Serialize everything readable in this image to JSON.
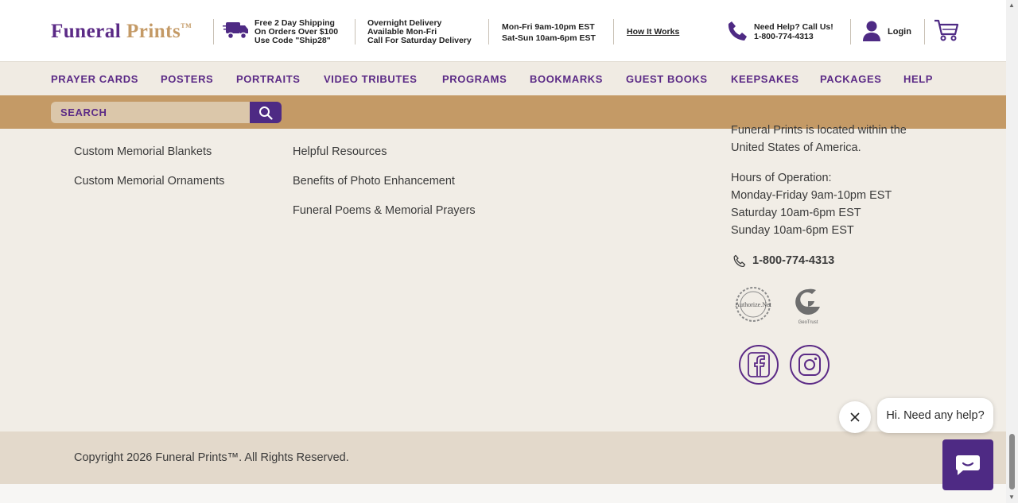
{
  "brand": {
    "logo_word1": "Funeral",
    "logo_word2": "Prints",
    "logo_tm": "TM"
  },
  "header": {
    "shipping": [
      "Free 2 Day Shipping",
      "On Orders Over $100",
      "Use Code \"Ship28\""
    ],
    "overnight": [
      "Overnight Delivery",
      "Available Mon-Fri",
      "Call For Saturday Delivery"
    ],
    "hours": [
      "Mon-Fri 9am-10pm EST",
      "Sat-Sun 10am-6pm EST"
    ],
    "how_it_works": "How It Works",
    "help_line1": "Need Help? Call Us!",
    "help_line2": "1-800-774-4313",
    "login": "Login"
  },
  "nav": [
    "PRAYER CARDS",
    "POSTERS",
    "PORTRAITS",
    "VIDEO TRIBUTES",
    "PROGRAMS",
    "BOOKMARKS",
    "GUEST BOOKS",
    "KEEPSAKES",
    "PACKAGES",
    "HELP"
  ],
  "search": {
    "placeholder": "SEARCH"
  },
  "footer": {
    "col1": [
      "Custom Memorial Blankets",
      "Custom Memorial Ornaments"
    ],
    "col2": [
      "Helpful Resources",
      "Benefits of Photo Enhancement",
      "Funeral Poems & Memorial Prayers"
    ],
    "location_line1": "Funeral Prints is located within the",
    "location_line2": "United States of America.",
    "hours_title": "Hours of Operation:",
    "hours_lines": [
      "Monday-Friday 9am-10pm EST",
      "Saturday 10am-6pm EST",
      "Sunday 10am-6pm EST"
    ],
    "phone": "1-800-774-4313",
    "badge1": "Authorize.Net",
    "badge2": "GeoTrust",
    "copyright": "Copyright 2026 Funeral Prints™. All Rights Reserved."
  },
  "chat": {
    "bubble": "Hi. Need any help?"
  },
  "colors": {
    "purple": "#5b2a86",
    "gold": "#c49a66",
    "cream": "#f1ede6"
  }
}
